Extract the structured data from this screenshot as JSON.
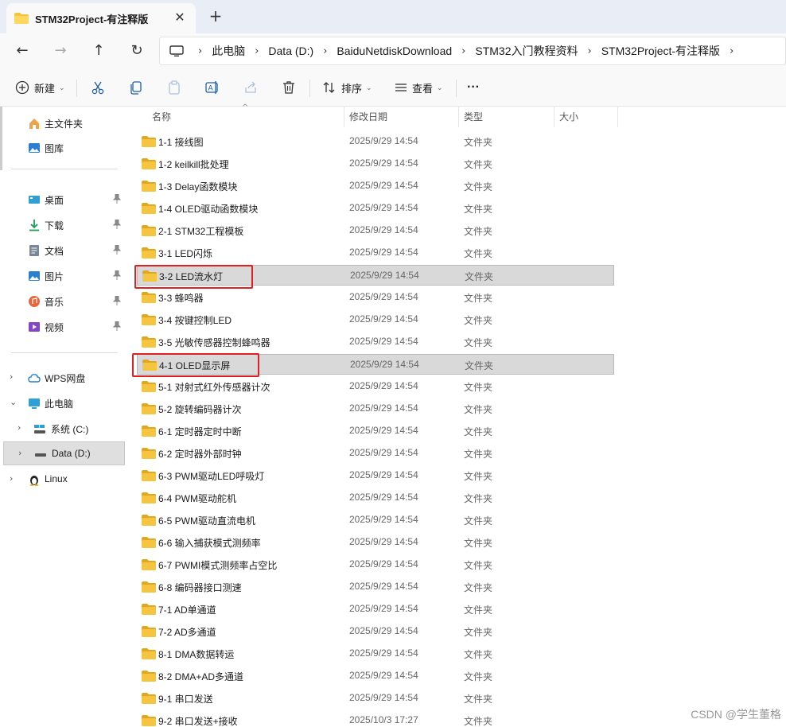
{
  "window": {
    "tab_title": "STM32Project-有注释版",
    "close_glyph": "✕",
    "new_tab_glyph": "+"
  },
  "nav": {
    "back_glyph": "←",
    "forward_glyph": "→",
    "up_glyph": "↑",
    "refresh_glyph": "↻"
  },
  "breadcrumb": {
    "separator": "›",
    "items": [
      "此电脑",
      "Data (D:)",
      "BaiduNetdiskDownload",
      "STM32入门教程资料",
      "STM32Project-有注释版"
    ]
  },
  "toolbar": {
    "new_label": "新建",
    "sort_label": "排序",
    "view_label": "查看",
    "more_glyph": "···",
    "caret_glyph": "⌄"
  },
  "sidebar": {
    "pin_glyph": "📌",
    "expand_glyph": "›",
    "collapse_glyph": "⌄",
    "quick": [
      {
        "label": "主文件夹",
        "icon": "home-icon"
      },
      {
        "label": "图库",
        "icon": "gallery-icon"
      }
    ],
    "pinned": [
      {
        "label": "桌面",
        "icon": "desktop-icon"
      },
      {
        "label": "下载",
        "icon": "download-icon"
      },
      {
        "label": "文档",
        "icon": "document-icon"
      },
      {
        "label": "图片",
        "icon": "pictures-icon"
      },
      {
        "label": "音乐",
        "icon": "music-icon"
      },
      {
        "label": "视频",
        "icon": "video-icon"
      }
    ],
    "tree": [
      {
        "label": "WPS网盘",
        "icon": "cloud-icon"
      },
      {
        "label": "此电脑",
        "icon": "pc-icon"
      },
      {
        "label": "系统 (C:)",
        "icon": "drive-icon"
      },
      {
        "label": "Data (D:)",
        "icon": "drive-icon"
      },
      {
        "label": "Linux",
        "icon": "linux-icon"
      }
    ]
  },
  "columns": {
    "name": "名称",
    "modified": "修改日期",
    "type": "类型",
    "size": "大小",
    "sort_glyph": "^"
  },
  "files": [
    {
      "name": "1-1 接线图",
      "date": "2025/9/29 14:54",
      "type": "文件夹"
    },
    {
      "name": "1-2 keilkill批处理",
      "date": "2025/9/29 14:54",
      "type": "文件夹"
    },
    {
      "name": "1-3 Delay函数模块",
      "date": "2025/9/29 14:54",
      "type": "文件夹"
    },
    {
      "name": "1-4 OLED驱动函数模块",
      "date": "2025/9/29 14:54",
      "type": "文件夹"
    },
    {
      "name": "2-1 STM32工程模板",
      "date": "2025/9/29 14:54",
      "type": "文件夹"
    },
    {
      "name": "3-1 LED闪烁",
      "date": "2025/9/29 14:54",
      "type": "文件夹"
    },
    {
      "name": "3-2 LED流水灯",
      "date": "2025/9/29 14:54",
      "type": "文件夹",
      "highlighted": true
    },
    {
      "name": "3-3 蜂鸣器",
      "date": "2025/9/29 14:54",
      "type": "文件夹"
    },
    {
      "name": "3-4 按键控制LED",
      "date": "2025/9/29 14:54",
      "type": "文件夹"
    },
    {
      "name": "3-5 光敏传感器控制蜂鸣器",
      "date": "2025/9/29 14:54",
      "type": "文件夹"
    },
    {
      "name": "4-1 OLED显示屏",
      "date": "2025/9/29 14:54",
      "type": "文件夹",
      "highlighted": true
    },
    {
      "name": "5-1 对射式红外传感器计次",
      "date": "2025/9/29 14:54",
      "type": "文件夹"
    },
    {
      "name": "5-2 旋转编码器计次",
      "date": "2025/9/29 14:54",
      "type": "文件夹"
    },
    {
      "name": "6-1 定时器定时中断",
      "date": "2025/9/29 14:54",
      "type": "文件夹"
    },
    {
      "name": "6-2 定时器外部时钟",
      "date": "2025/9/29 14:54",
      "type": "文件夹"
    },
    {
      "name": "6-3 PWM驱动LED呼吸灯",
      "date": "2025/9/29 14:54",
      "type": "文件夹"
    },
    {
      "name": "6-4 PWM驱动舵机",
      "date": "2025/9/29 14:54",
      "type": "文件夹"
    },
    {
      "name": "6-5 PWM驱动直流电机",
      "date": "2025/9/29 14:54",
      "type": "文件夹"
    },
    {
      "name": "6-6 输入捕获模式测频率",
      "date": "2025/9/29 14:54",
      "type": "文件夹"
    },
    {
      "name": "6-7 PWMI模式测频率占空比",
      "date": "2025/9/29 14:54",
      "type": "文件夹"
    },
    {
      "name": "6-8 编码器接口测速",
      "date": "2025/9/29 14:54",
      "type": "文件夹"
    },
    {
      "name": "7-1 AD单通道",
      "date": "2025/9/29 14:54",
      "type": "文件夹"
    },
    {
      "name": "7-2 AD多通道",
      "date": "2025/9/29 14:54",
      "type": "文件夹"
    },
    {
      "name": "8-1 DMA数据转运",
      "date": "2025/9/29 14:54",
      "type": "文件夹"
    },
    {
      "name": "8-2 DMA+AD多通道",
      "date": "2025/9/29 14:54",
      "type": "文件夹"
    },
    {
      "name": "9-1 串口发送",
      "date": "2025/9/29 14:54",
      "type": "文件夹"
    },
    {
      "name": "9-2 串口发送+接收",
      "date": "2025/10/3 17:27",
      "type": "文件夹"
    }
  ],
  "watermark": "CSDN @学生董格",
  "colors": {
    "folder": "#f5c542",
    "folder_dark": "#e0a820",
    "highlight_box": "#e02020",
    "accent": "#0067c0"
  }
}
